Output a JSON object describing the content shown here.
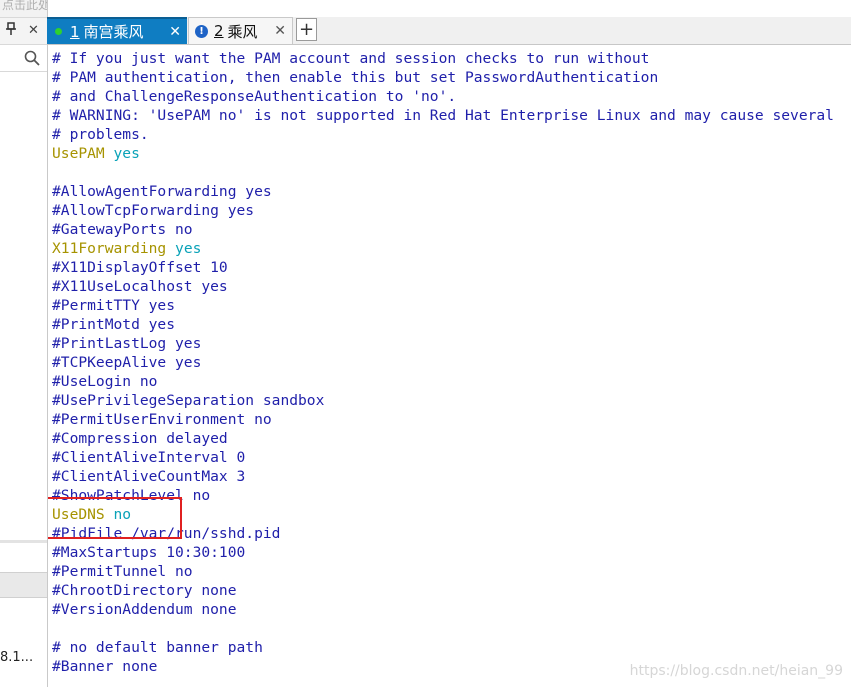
{
  "sidebar": {
    "top_hint": "点击此处的请文文指",
    "pin_glyph": "📌",
    "close_glyph": "✕",
    "search_icon": "magnifier",
    "bottom_item": "8.1..."
  },
  "tabs": [
    {
      "number": "1",
      "label": "南宫乘风",
      "status": "connected",
      "status_color": "#2fd12f",
      "close_glyph": "✕",
      "active": true
    },
    {
      "number": "2",
      "label": "乘风",
      "status": "warning",
      "status_color": "#1e63c6",
      "status_glyph": "!",
      "close_glyph": "✕",
      "active": false
    }
  ],
  "add_tab_label": "+",
  "terminal": {
    "colors": {
      "comment": "#1f1faa",
      "keyword": "#a69300",
      "value": "#0aa2b8",
      "highlight": "#e02020"
    },
    "lines": [
      {
        "type": "comment",
        "text": "# If you just want the PAM account and session checks to run without"
      },
      {
        "type": "comment",
        "text": "# PAM authentication, then enable this but set PasswordAuthentication"
      },
      {
        "type": "comment",
        "text": "# and ChallengeResponseAuthentication to 'no'."
      },
      {
        "type": "comment",
        "text": "# WARNING: 'UsePAM no' is not supported in Red Hat Enterprise Linux and may cause several"
      },
      {
        "type": "comment",
        "text": "# problems."
      },
      {
        "type": "kv",
        "key": "UsePAM",
        "value": "yes"
      },
      {
        "type": "blank",
        "text": ""
      },
      {
        "type": "comment",
        "text": "#AllowAgentForwarding yes"
      },
      {
        "type": "comment",
        "text": "#AllowTcpForwarding yes"
      },
      {
        "type": "comment",
        "text": "#GatewayPorts no"
      },
      {
        "type": "kv",
        "key": "X11Forwarding",
        "value": "yes"
      },
      {
        "type": "comment",
        "text": "#X11DisplayOffset 10"
      },
      {
        "type": "comment",
        "text": "#X11UseLocalhost yes"
      },
      {
        "type": "comment",
        "text": "#PermitTTY yes"
      },
      {
        "type": "comment",
        "text": "#PrintMotd yes"
      },
      {
        "type": "comment",
        "text": "#PrintLastLog yes"
      },
      {
        "type": "comment",
        "text": "#TCPKeepAlive yes"
      },
      {
        "type": "comment",
        "text": "#UseLogin no"
      },
      {
        "type": "comment",
        "text": "#UsePrivilegeSeparation sandbox"
      },
      {
        "type": "comment",
        "text": "#PermitUserEnvironment no"
      },
      {
        "type": "comment",
        "text": "#Compression delayed"
      },
      {
        "type": "comment",
        "text": "#ClientAliveInterval 0"
      },
      {
        "type": "comment",
        "text": "#ClientAliveCountMax 3"
      },
      {
        "type": "comment",
        "text": "#ShowPatchLevel no"
      },
      {
        "type": "kv",
        "key": "UseDNS",
        "value": "no"
      },
      {
        "type": "comment",
        "text": "#PidFile /var/run/sshd.pid"
      },
      {
        "type": "comment",
        "text": "#MaxStartups 10:30:100"
      },
      {
        "type": "comment",
        "text": "#PermitTunnel no"
      },
      {
        "type": "comment",
        "text": "#ChrootDirectory none"
      },
      {
        "type": "comment",
        "text": "#VersionAddendum none"
      },
      {
        "type": "blank",
        "text": ""
      },
      {
        "type": "comment",
        "text": "# no default banner path"
      },
      {
        "type": "comment",
        "text": "#Banner none"
      }
    ]
  },
  "watermark": "https://blog.csdn.net/heian_99"
}
